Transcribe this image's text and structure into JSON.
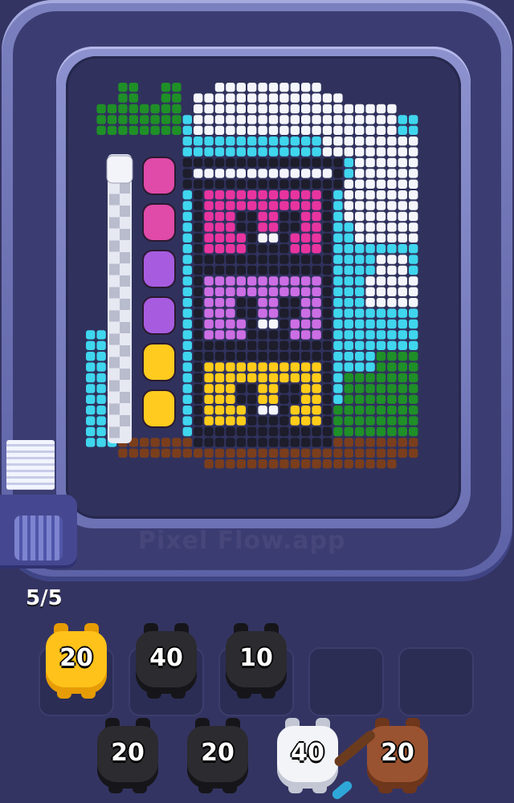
{
  "watermark": {
    "text": "Pixel Flow.app"
  },
  "level": {
    "counter": "5/5"
  },
  "palette": {
    "sky": "#3fd6ee",
    "cloud": "#f4f6fb",
    "grass": "#1f8f27",
    "dirt": "#7a3e1d",
    "magenta": "#e8349f",
    "lilac": "#cc6ee4",
    "yellow": "#ffcc1a",
    "outline": "#1d1d2b",
    "frame": "#d8dbe6"
  },
  "queue": {
    "pigs": [
      {
        "color": "pink"
      },
      {
        "color": "pink"
      },
      {
        "color": "purple"
      },
      {
        "color": "purple"
      },
      {
        "color": "yellow"
      },
      {
        "color": "yellow"
      }
    ]
  },
  "pigs_top": [
    {
      "value": "20",
      "color": "#ffc21a",
      "shade": "#e79c05"
    },
    {
      "value": "40",
      "color": "#2b2b30",
      "shade": "#16161a"
    },
    {
      "value": "10",
      "color": "#2b2b30",
      "shade": "#16161a"
    }
  ],
  "slots_empty": 2,
  "pigs_bottom": [
    {
      "value": "20",
      "color": "#2b2b30",
      "shade": "#16161a"
    },
    {
      "value": "20",
      "color": "#2b2b30",
      "shade": "#16161a"
    },
    {
      "value": "40",
      "color": "#f2f4f8",
      "shade": "#c3c7d4"
    },
    {
      "value": "20",
      "color": "#9a5330",
      "shade": "#6e361b"
    }
  ]
}
